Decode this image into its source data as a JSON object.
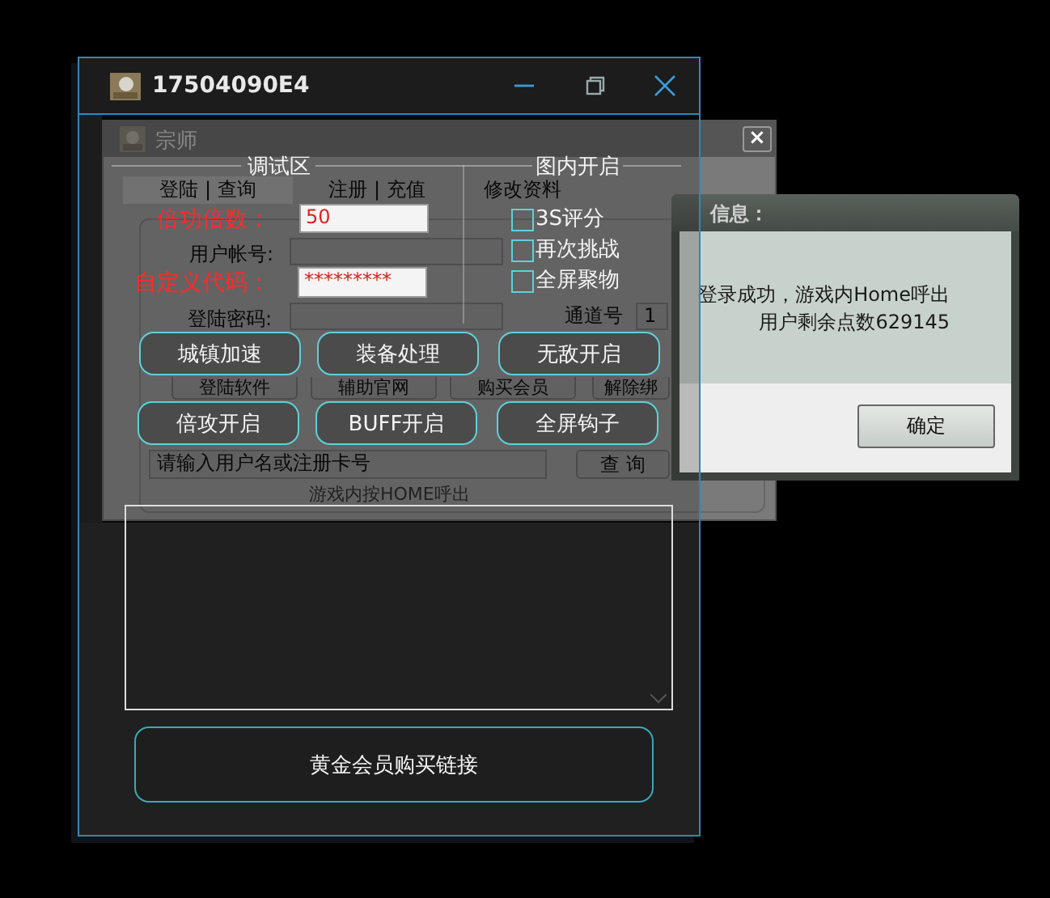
{
  "background_window": {
    "title": "宗师",
    "close": "×",
    "tabs": [
      {
        "label": "登陆 | 查询",
        "selected": true
      },
      {
        "label": "注册 | 充值",
        "selected": false
      },
      {
        "label": "修改资料",
        "selected": false
      }
    ],
    "account_label": "用户帐号:",
    "password_label": "登陆密码:",
    "channel_label": "通道号",
    "channel_value": "1",
    "buttons": [
      "登陆软件",
      "辅助官网",
      "购买会员",
      "解除绑"
    ],
    "search": {
      "placeholder": "请输入用户名或注册卡号"
    },
    "search_button": "查 询",
    "hint": "游戏内按HOME呼出"
  },
  "info_dialog": {
    "title": "信息：",
    "lines": [
      "登录成功，游戏内Home呼出",
      "用户剩余点数629145"
    ],
    "button": "确定"
  },
  "main_window": {
    "title": "17504090E4",
    "debug_group": {
      "title": "调试区",
      "fields": [
        {
          "label": "倍功倍数：",
          "value": "50"
        },
        {
          "label": "自定义代码：",
          "value": "*********"
        }
      ]
    },
    "map_group": {
      "title": "图内开启",
      "options": [
        {
          "label": "3S评分",
          "checked": false
        },
        {
          "label": "再次挑战",
          "checked": false
        },
        {
          "label": "全屏聚物",
          "checked": false
        }
      ]
    },
    "buttons": [
      "城镇加速",
      "装备处理",
      "无敌开启",
      "倍攻开启",
      "BUFF开启",
      "全屏钩子"
    ],
    "purchase_button": "黄金会员购买链接"
  }
}
